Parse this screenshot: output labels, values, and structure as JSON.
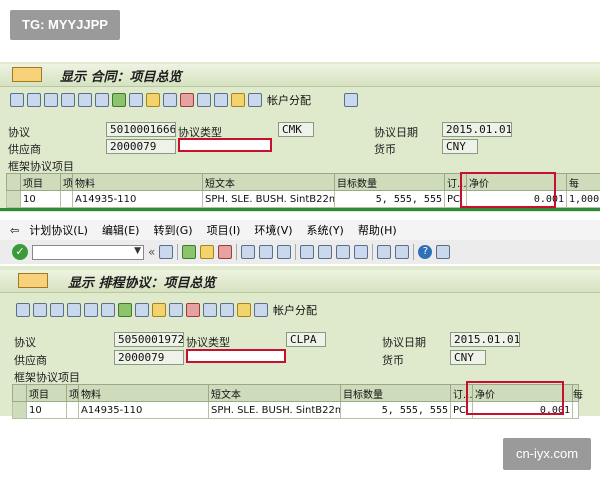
{
  "watermark_tl": "TG: MYYJJPP",
  "watermark_br": "cn-iyx.com",
  "menu": [
    "计划协议(L)",
    "编辑(E)",
    "转到(G)",
    "项目(I)",
    "环境(V)",
    "系统(Y)",
    "帮助(H)"
  ],
  "top": {
    "title": "显示 合同：项目总览",
    "account_assign": "帐户分配",
    "labels": {
      "agreement": "协议",
      "agreement_type": "协议类型",
      "vendor": "供应商",
      "agreement_date": "协议日期",
      "currency": "货币",
      "section": "框架协议项目"
    },
    "values": {
      "agreement": "5010001666",
      "agreement_type": "CMK",
      "vendor": "2000079",
      "agreement_date": "2015.01.01",
      "currency": "CNY"
    },
    "columns": [
      "项目",
      "项",
      "物料",
      "短文本",
      "目标数量",
      "订...",
      "净价",
      "每"
    ],
    "row": {
      "item": "10",
      "material": "A14935-110",
      "short_text": "SPH. SLE. BUSH. SintB22mo...",
      "target_qty": "5, 555, 555",
      "unit": "PC",
      "net_price": "0.001",
      "per": "1,000"
    }
  },
  "bottom": {
    "title": "显示 排程协议：项目总览",
    "account_assign": "帐户分配",
    "labels": {
      "agreement": "协议",
      "agreement_type": "协议类型",
      "vendor": "供应商",
      "agreement_date": "协议日期",
      "currency": "货币",
      "section": "框架协议项目"
    },
    "values": {
      "agreement": "5050001972",
      "agreement_type": "CLPA",
      "vendor": "2000079",
      "agreement_date": "2015.01.01",
      "currency": "CNY"
    },
    "columns": [
      "项目",
      "项",
      "物料",
      "短文本",
      "目标数量",
      "订...",
      "净价",
      "每"
    ],
    "row": {
      "item": "10",
      "material": "A14935-110",
      "short_text": "SPH. SLE. BUSH. SintB22mo...",
      "target_qty": "5, 555, 555",
      "unit": "PC",
      "net_price": "0.001"
    }
  }
}
